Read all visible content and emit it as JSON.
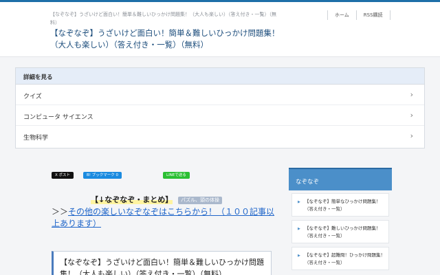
{
  "header": {
    "description": "【なぞなぞ】うざいけど面白い！簡単＆難しいひっかけ問題集！（大人も楽しい）（答え付き・一覧）（無料）",
    "title": "【なぞなぞ】うざいけど面白い！簡単＆難しいひっかけ問題集！（大人も楽しい）（答え付き・一覧）（無料）",
    "nav": [
      "ホーム",
      "RSS購読"
    ]
  },
  "detail": {
    "heading": "詳細を見る",
    "items": [
      "クイズ",
      "コンピュータ サイエンス",
      "生物科学"
    ]
  },
  "share": {
    "x_label": "X ポスト",
    "hatena_label": "B! ブックマーク 0",
    "line_label": "LINEで送る"
  },
  "tag": {
    "main": "【↓なぞなぞ・まとめ】",
    "badge": "パズル、頭の体操"
  },
  "more": {
    "arrows": "＞＞",
    "link": "その他の楽しいなぞなぞはこちらから！（１００記事以上あります）"
  },
  "article": {
    "title": "【なぞなぞ】うざいけど面白い！簡単＆難しいひっかけ問題集！（大人も楽しい）（答え付き・一覧）（無料）"
  },
  "sidebar": {
    "heading": "なぞなぞ",
    "items": [
      "【なぞなぞ】簡単なひっかけ問題集！（答え付き・一覧）",
      "【なぞなぞ】難しいひっかけ問題集！（答え付き・一覧）",
      "【なぞなぞ】超難問！ひっかけ問題集！（答え付き・一覧）"
    ]
  },
  "colors": {
    "accent": "#1e6fa8",
    "sidebar_head": "#4b8fc9",
    "link": "#1d64c9"
  }
}
